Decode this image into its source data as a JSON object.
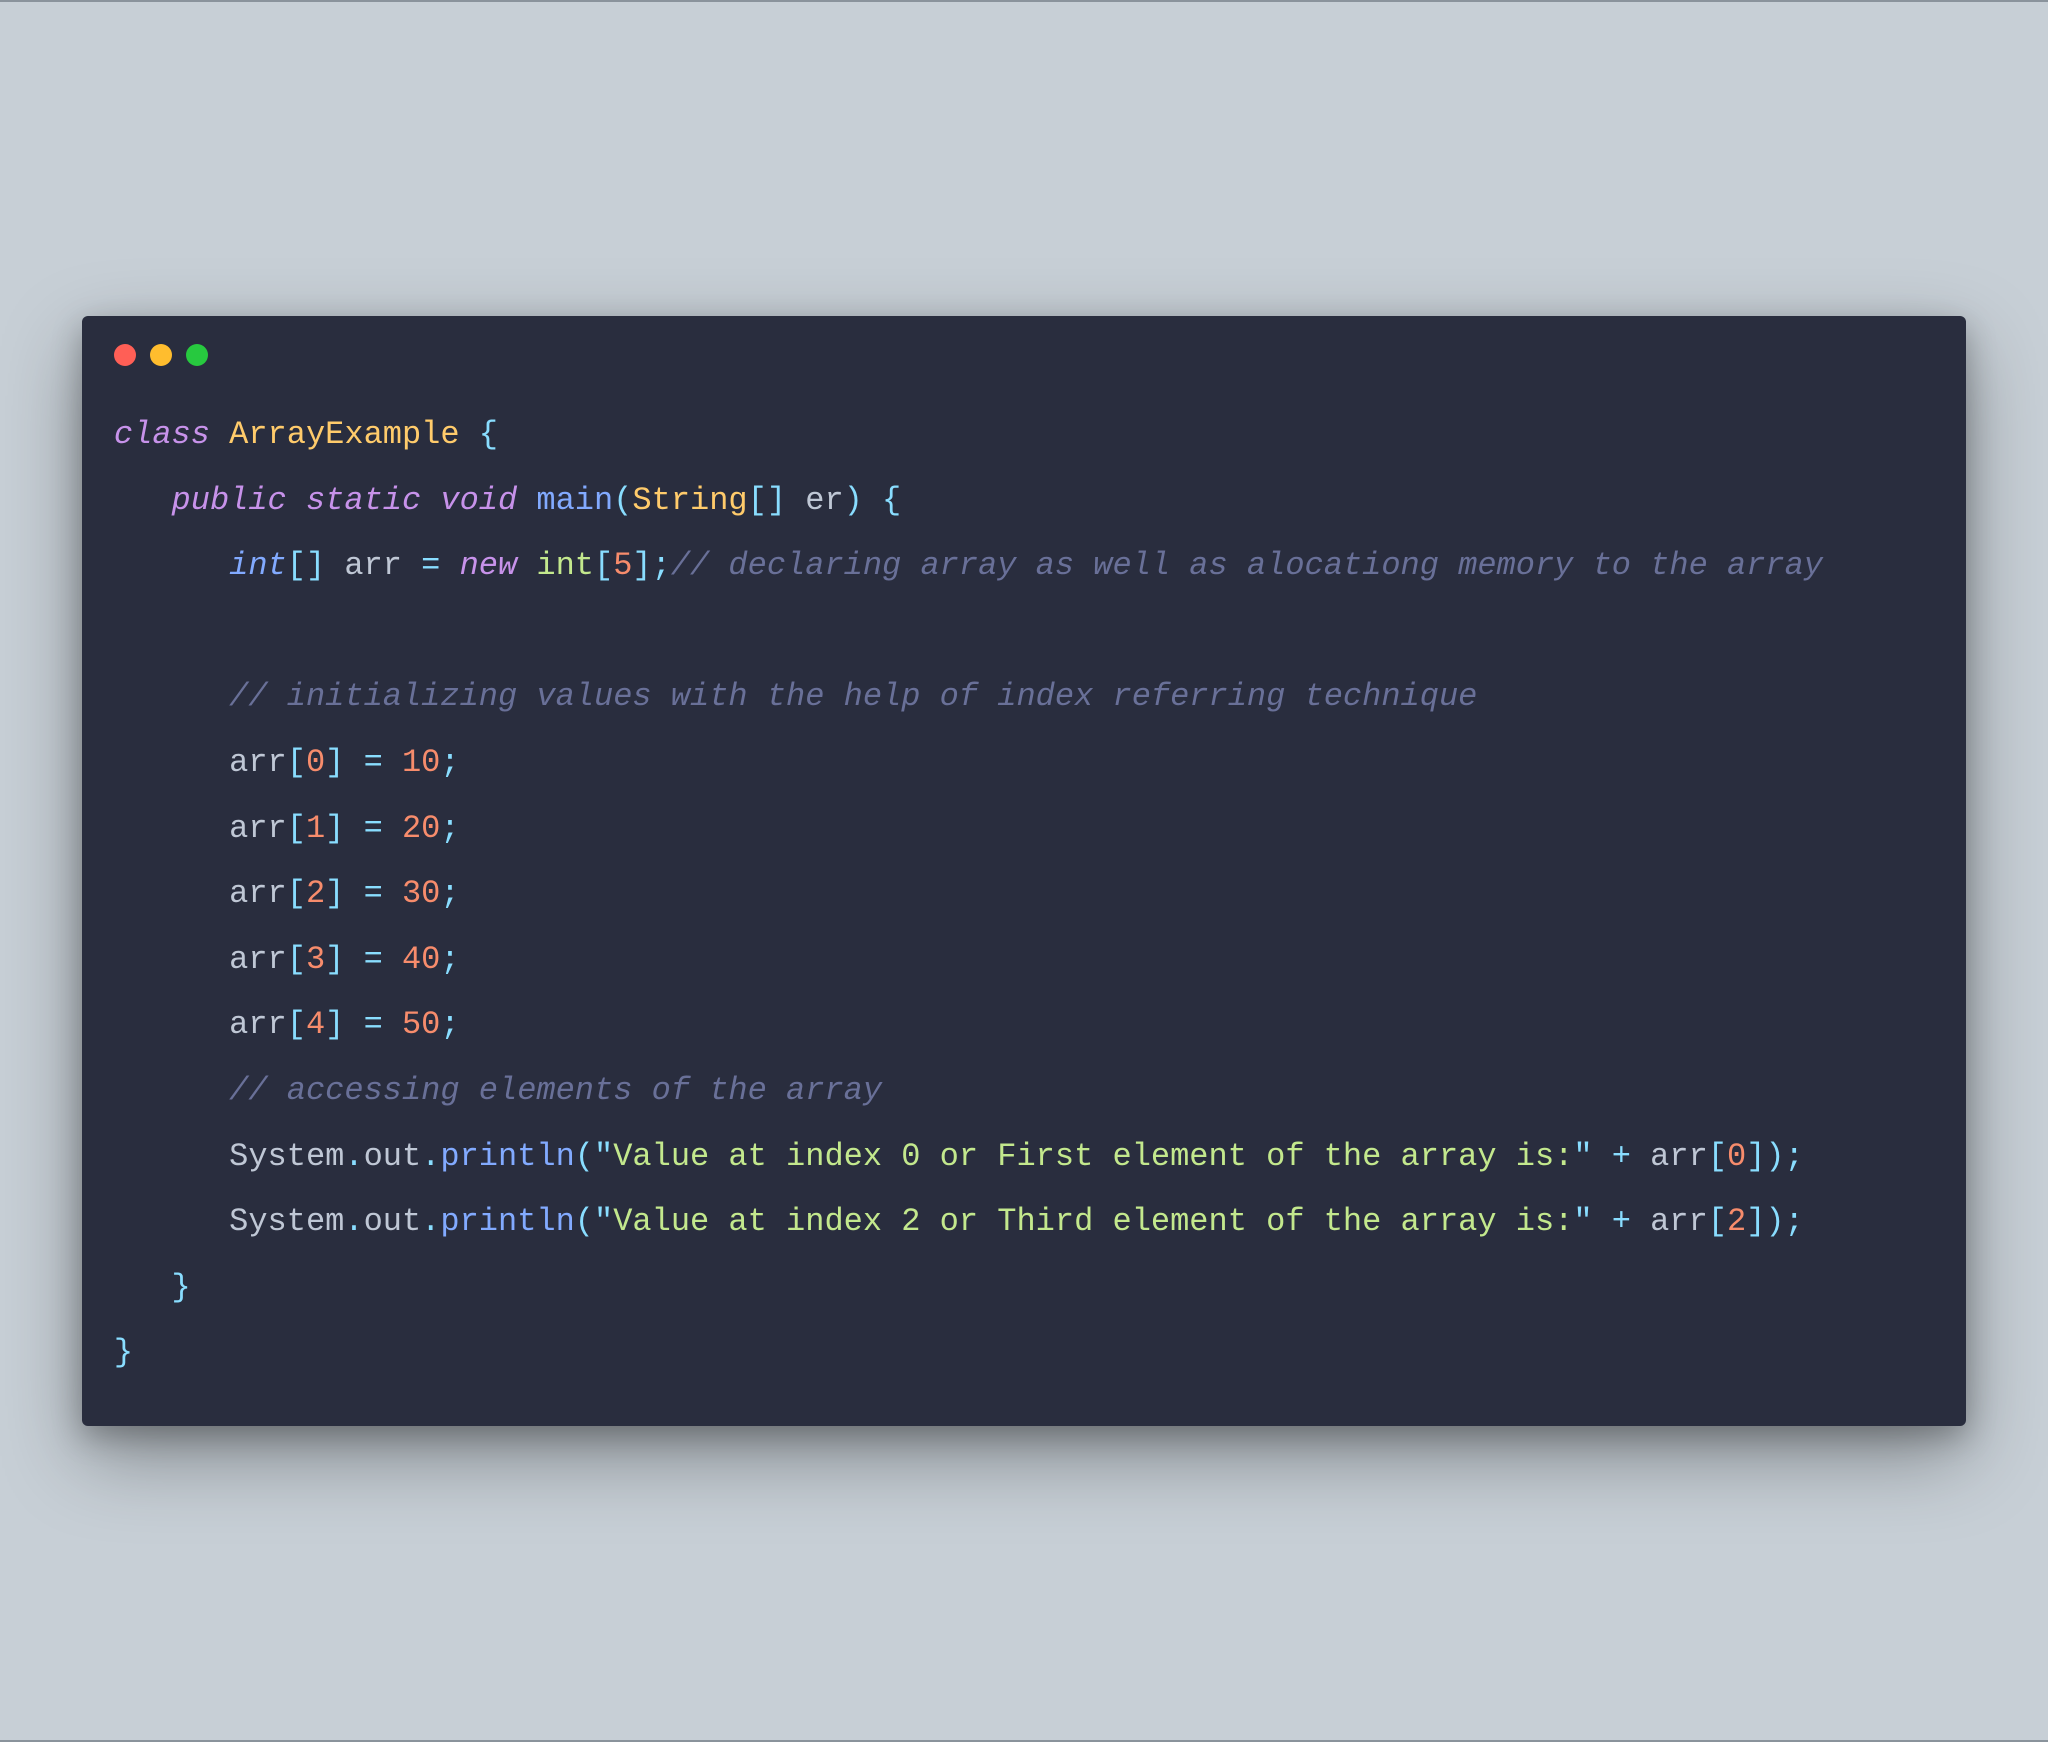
{
  "code": {
    "class_kw": "class",
    "class_name": "ArrayExample",
    "open_brace": "{",
    "close_brace": "}",
    "public_kw": "public",
    "static_kw": "static",
    "void_kw": "void",
    "main_fn": "main",
    "open_paren": "(",
    "close_paren": ")",
    "string_type": "String",
    "brackets": "[]",
    "param_name": "er",
    "int_kw": "int",
    "arr_ident": "arr",
    "equals": "=",
    "new_kw": "new",
    "open_bracket": "[",
    "close_bracket": "]",
    "size": "5",
    "semicolon": ";",
    "comment_decl": "// declaring array as well as alocationg memory to the array",
    "comment_init": "// initializing values with the help of index referring technique",
    "idx0": "0",
    "val0": "10",
    "idx1": "1",
    "val1": "20",
    "idx2": "2",
    "val2": "30",
    "idx3": "3",
    "val3": "40",
    "idx4": "4",
    "val4": "50",
    "comment_access": "// accessing elements of the array",
    "system": "System",
    "dot": ".",
    "out": "out",
    "println": "println",
    "quote": "\"",
    "msg1": "Value at index 0 or First element of the array is:",
    "plus": "+",
    "msg2": "Value at index 2 or Third element of the array is:",
    "idx_print1": "0",
    "idx_print2": "2"
  }
}
